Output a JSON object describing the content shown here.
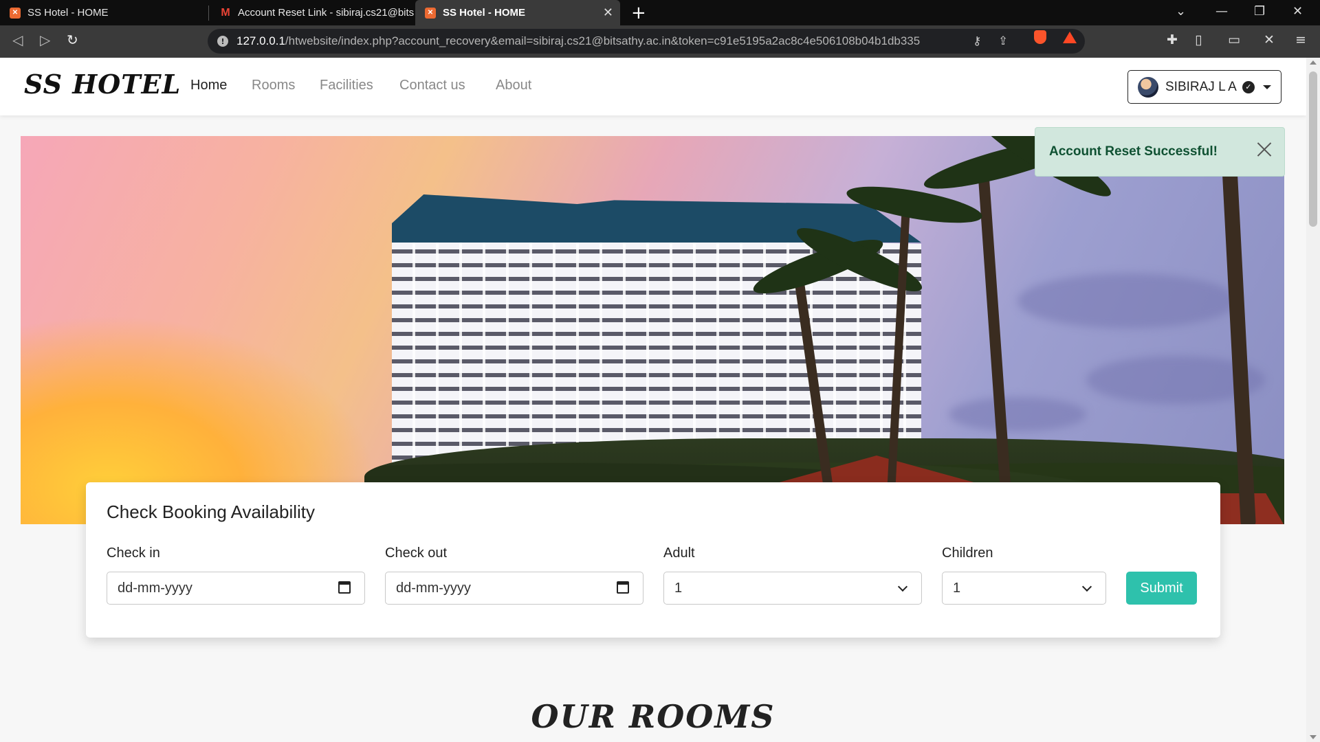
{
  "browser": {
    "tabs": [
      {
        "title": "SS Hotel - HOME",
        "favicon": "xampp-icon",
        "active": false
      },
      {
        "title": "Account Reset Link - sibiraj.cs21@bits",
        "favicon": "gmail-icon",
        "active": false
      },
      {
        "title": "SS Hotel - HOME",
        "favicon": "xampp-icon",
        "active": true
      }
    ],
    "url_host": "127.0.0.1",
    "url_path": "/htwebsite/index.php?account_recovery&email=sibiraj.cs21@bitsathy.ac.in&token=c91e5195a2ac8c4e506108b04b1db335"
  },
  "navbar": {
    "brand": "SS HOTEL",
    "links": [
      "Home",
      "Rooms",
      "Facilities",
      "Contact us",
      "About"
    ],
    "active_link": "Home",
    "user_name": "SIBIRAJ L A"
  },
  "toast": {
    "message": "Account Reset Successful!",
    "color": "#0f5132",
    "background": "#d1e7dd"
  },
  "booking": {
    "title": "Check Booking Availability",
    "checkin_label": "Check in",
    "checkin_placeholder": "dd-mm-yyyy",
    "checkout_label": "Check out",
    "checkout_placeholder": "dd-mm-yyyy",
    "adult_label": "Adult",
    "adult_value": "1",
    "children_label": "Children",
    "children_value": "1",
    "submit_label": "Submit",
    "accent": "#2ec1ac"
  },
  "section": {
    "title": "OUR ROOMS"
  }
}
